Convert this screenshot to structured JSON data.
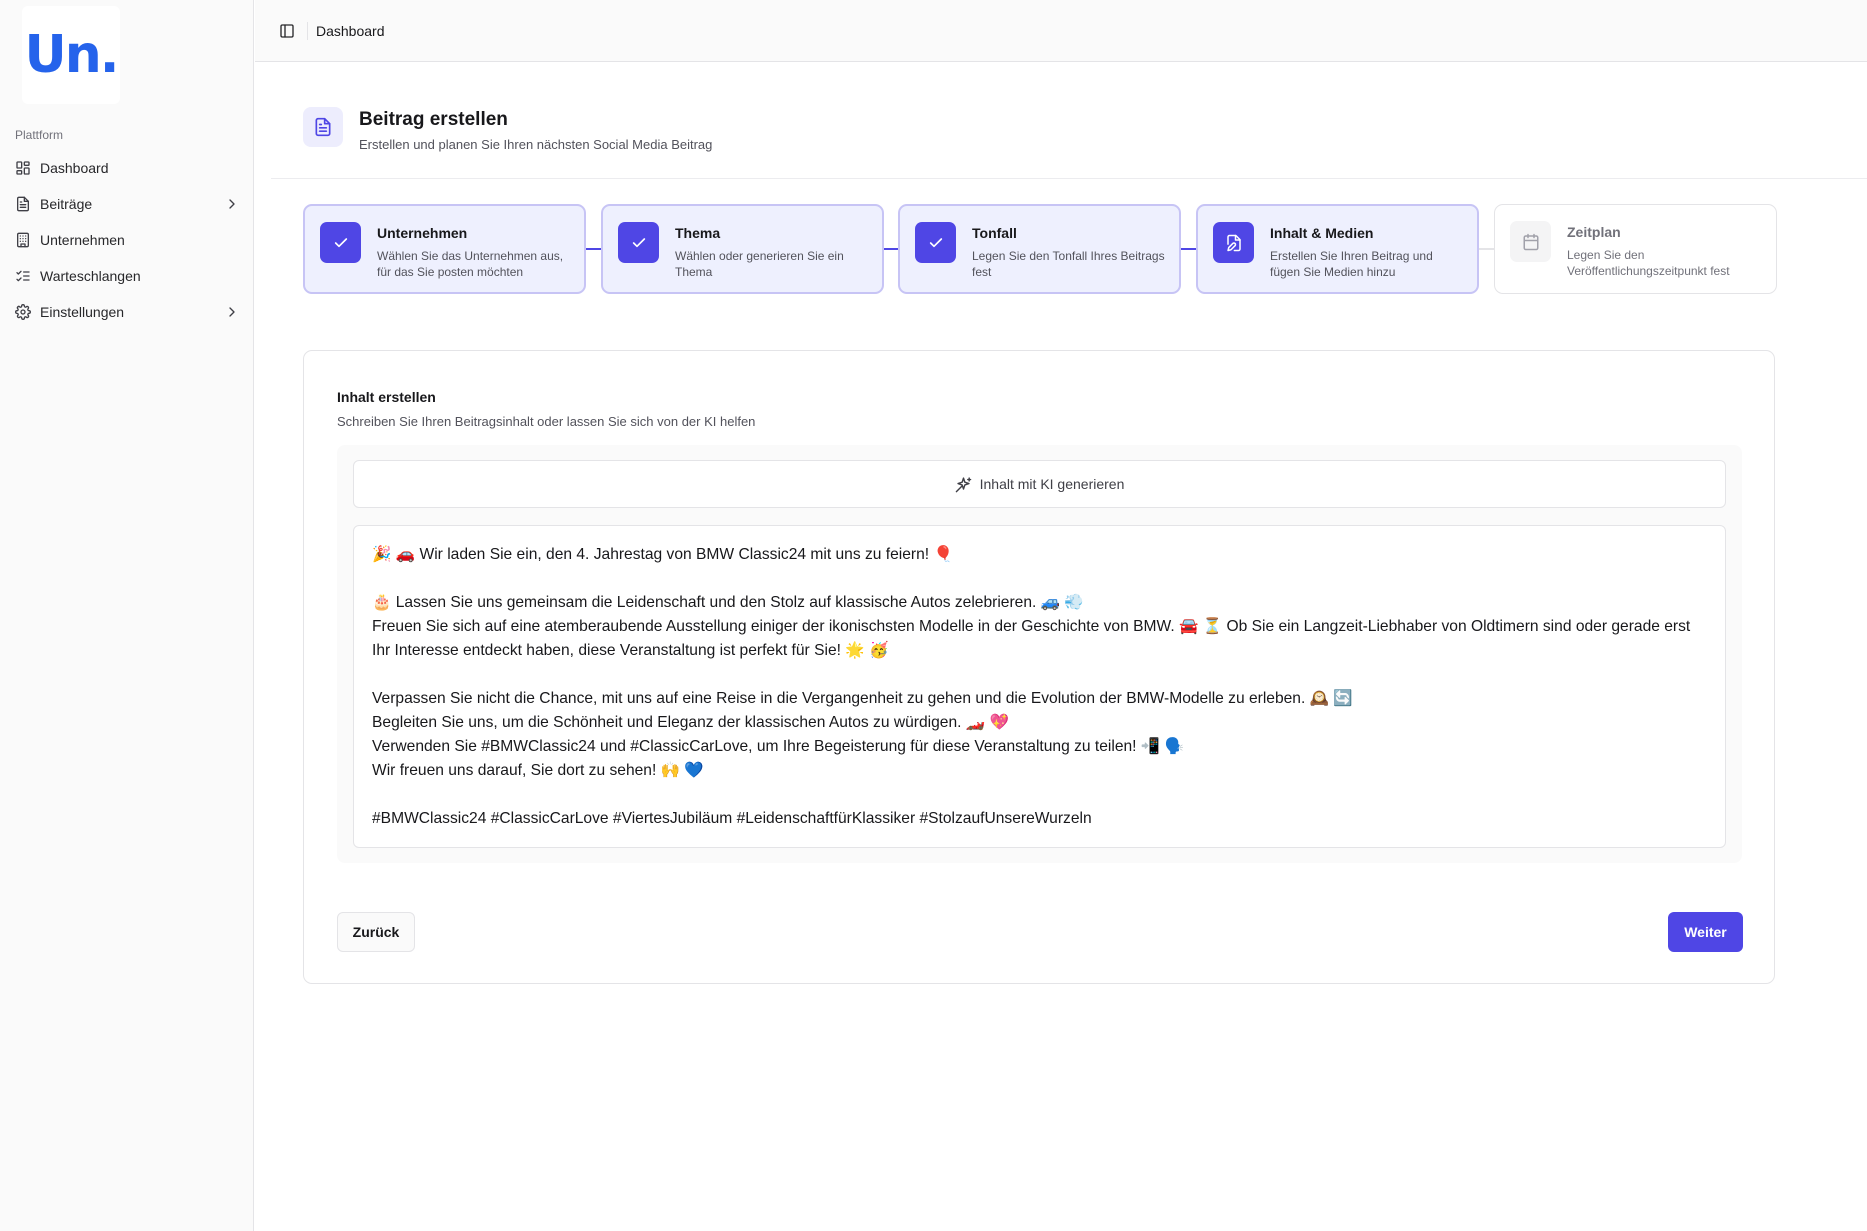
{
  "sidebar": {
    "logo_text": "Un.",
    "group_label": "Plattform",
    "items": [
      {
        "label": "Dashboard",
        "icon": "grid-icon"
      },
      {
        "label": "Beiträge",
        "icon": "document-icon",
        "has_children": true
      },
      {
        "label": "Unternehmen",
        "icon": "building-icon"
      },
      {
        "label": "Warteschlangen",
        "icon": "list-checks-icon"
      },
      {
        "label": "Einstellungen",
        "icon": "gear-icon",
        "has_children": true
      }
    ]
  },
  "header": {
    "breadcrumb": "Dashboard"
  },
  "page": {
    "title": "Beitrag erstellen",
    "subtitle": "Erstellen und planen Sie Ihren nächsten Social Media Beitrag"
  },
  "steps": [
    {
      "title": "Unternehmen",
      "desc_line1": "Wählen Sie das Unternehmen aus,",
      "desc_line2": "für das Sie posten möchten",
      "status": "completed",
      "icon": "check-icon"
    },
    {
      "title": "Thema",
      "desc_line1": "Wählen oder generieren Sie ein",
      "desc_line2": "Thema",
      "status": "completed",
      "icon": "check-icon"
    },
    {
      "title": "Tonfall",
      "desc_line1": "Legen Sie den Tonfall Ihres Beitrags",
      "desc_line2": "fest",
      "status": "completed",
      "icon": "check-icon"
    },
    {
      "title": "Inhalt & Medien",
      "desc_line1": "Erstellen Sie Ihren Beitrag und",
      "desc_line2": "fügen Sie Medien hinzu",
      "status": "current",
      "icon": "file-edit-icon"
    },
    {
      "title": "Zeitplan",
      "desc_line1": "Legen Sie den",
      "desc_line2": "Veröffentlichungszeitpunkt fest",
      "status": "pending",
      "icon": "calendar-icon"
    }
  ],
  "card": {
    "title": "Inhalt erstellen",
    "subtitle": "Schreiben Sie Ihren Beitragsinhalt oder lassen Sie sich von der KI helfen",
    "ai_button_label": "Inhalt mit KI generieren",
    "content": "🎉 🚗 Wir laden Sie ein, den 4. Jahrestag von BMW Classic24 mit uns zu feiern! 🎈\n\n🎂 Lassen Sie uns gemeinsam die Leidenschaft und den Stolz auf klassische Autos zelebrieren. 🚙 💨\nFreuen Sie sich auf eine atemberaubende Ausstellung einiger der ikonischsten Modelle in der Geschichte von BMW. 🚘 ⏳ Ob Sie ein Langzeit-Liebhaber von Oldtimern sind oder gerade erst Ihr Interesse entdeckt haben, diese Veranstaltung ist perfekt für Sie! 🌟 🥳\n\nVerpassen Sie nicht die Chance, mit uns auf eine Reise in die Vergangenheit zu gehen und die Evolution der BMW-Modelle zu erleben. 🕰️ 🔄\nBegleiten Sie uns, um die Schönheit und Eleganz der klassischen Autos zu würdigen. 🏎️ 💖\nVerwenden Sie #BMWClassic24 und #ClassicCarLove, um Ihre Begeisterung für diese Veranstaltung zu teilen! 📲 🗣️\nWir freuen uns darauf, Sie dort zu sehen! 🙌 💙\n\n#BMWClassic24 #ClassicCarLove #ViertesJubiläum #LeidenschaftfürKlassiker #StolzaufUnsereWurzeln",
    "back_label": "Zurück",
    "next_label": "Weiter"
  },
  "colors": {
    "accent": "#4f46e5",
    "logo": "#2563eb",
    "step_active_bg": "#eef0fe",
    "step_active_border": "#c7c4f5"
  }
}
